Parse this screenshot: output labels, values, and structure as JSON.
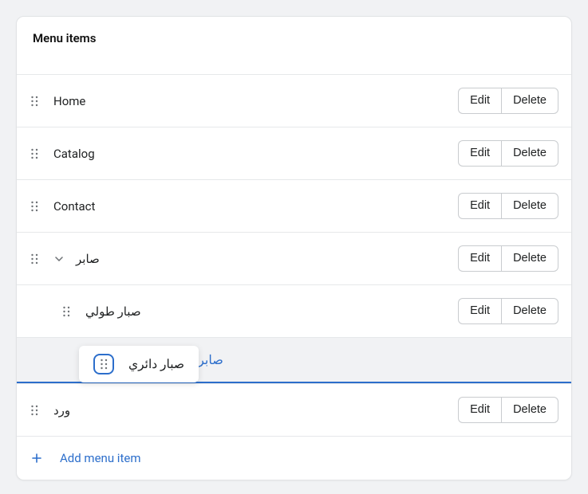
{
  "header": {
    "title": "Menu items"
  },
  "buttons": {
    "edit": "Edit",
    "delete": "Delete"
  },
  "add": {
    "label": "Add menu item"
  },
  "items": [
    {
      "label": "Home"
    },
    {
      "label": "Catalog"
    },
    {
      "label": "Contact"
    },
    {
      "label": "صابر",
      "expanded": true
    },
    {
      "label": "صبار طولي",
      "child": true
    }
  ],
  "drag": {
    "chip_label": "صبار دائري",
    "placeholder": "صابر د"
  },
  "after": [
    {
      "label": "ورد"
    }
  ]
}
